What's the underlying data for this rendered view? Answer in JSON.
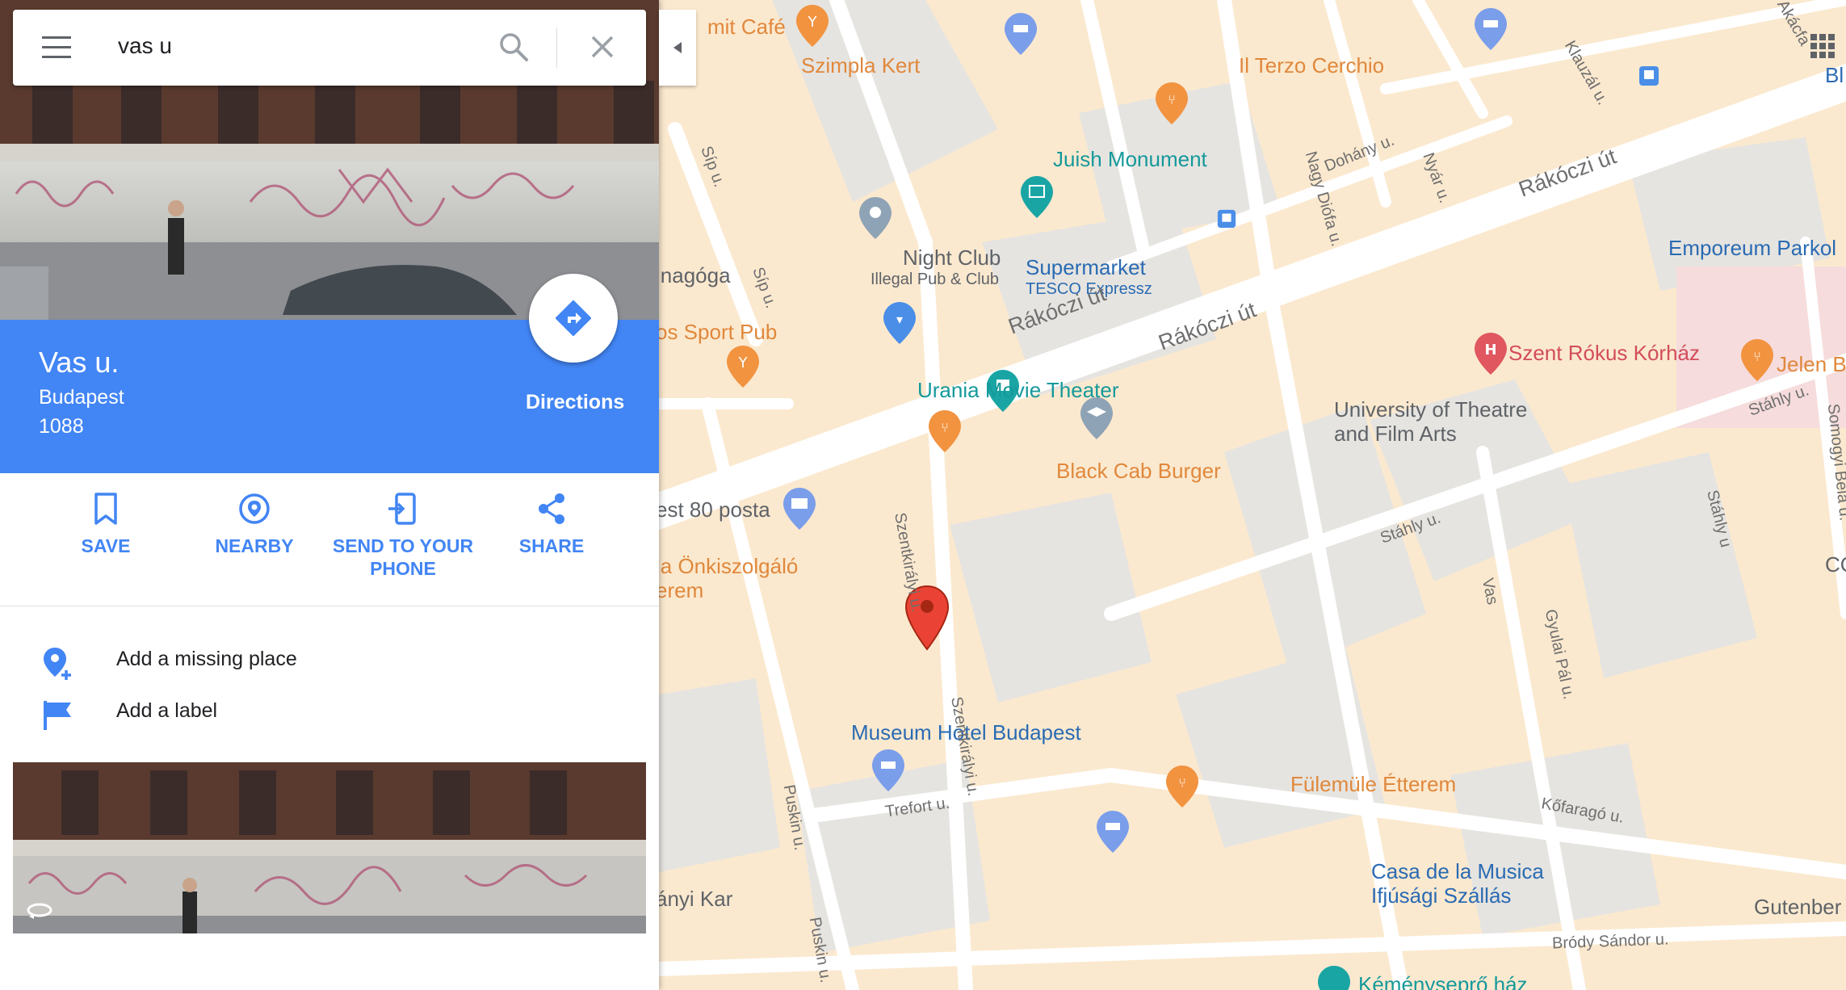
{
  "search": {
    "query": "vas u"
  },
  "place": {
    "name": "Vas u.",
    "city": "Budapest",
    "postal_code": "1088",
    "directions_label": "Directions"
  },
  "actions": [
    {
      "label": "SAVE",
      "icon": "bookmark-icon"
    },
    {
      "label": "NEARBY",
      "icon": "nearby-icon"
    },
    {
      "label": "SEND TO YOUR PHONE",
      "icon": "send-to-phone-icon"
    },
    {
      "label": "SHARE",
      "icon": "share-icon"
    }
  ],
  "list": [
    {
      "label": "Add a missing place",
      "icon": "add-place-icon"
    },
    {
      "label": "Add a label",
      "icon": "flag-icon"
    }
  ],
  "colors": {
    "accent": "#4285f4",
    "map_block": "#fbe9cf",
    "map_road": "#ffffff",
    "marker": "#ea4335",
    "poi_orange": "#e0883c",
    "poi_teal": "#15999b"
  },
  "map": {
    "poi": {
      "szimpla_cafe": "mit Café",
      "szimpla_kert": "Szimpla Kert",
      "il_terzo": "Il Terzo Cerchio",
      "juish": "Juish Monument",
      "night_club": "Night Club",
      "night_club_sub": "Illegal Pub & Club",
      "supermarket": "Supermarket",
      "supermarket_sub": "TESCO Expressz",
      "emporeum": "Emporeum Parkol",
      "zsinagoga": "inagóga",
      "sport_pub": "os Sport Pub",
      "szent_rokus": "Szent Rókus Kórház",
      "jelen": "Jelen B",
      "urania": "Urania Movie Theater",
      "university_1": "University of Theatre",
      "university_2": "and Film Arts",
      "black_cab": "Black Cab Burger",
      "posta": "est 80 posta",
      "onkiszolgalo_1": "la Önkiszolgáló",
      "onkiszolgalo_2": "erem",
      "museum_hotel": "Museum Hotel Budapest",
      "fulemule": "Fülemüle Étterem",
      "casa_1": "Casa de la Musica",
      "casa_2": "Ifjúsági Szállás",
      "gutenberg": "Gutenber",
      "kar": "ányi Kar",
      "kemenysepro": "Kéményseprő ház",
      "bl": "Bl",
      "co": "CC"
    },
    "streets": {
      "rakoczi_1": "Rákóczi út",
      "rakoczi_2": "Rákóczi út",
      "rakoczi_3": "Rákóczi út",
      "sip_1": "Síp u.",
      "sip_2": "Síp u.",
      "dohany": "Dohány u.",
      "nyar": "Nyár u.",
      "nagy_diofa": "Nagy Diófa u.",
      "klauzal": "Klauzál u.",
      "akacfa": "Akácfa",
      "stahly_1": "Stáhly u.",
      "stahly_2": "Stáhly u.",
      "stahly_3": "Stáhly u",
      "szentkiralyi_1": "Szentkirályi u.",
      "szentkiralyi_2": "Szentkirályi u.",
      "vas": "Vas",
      "gyulai_pal": "Gyulai Pál u.",
      "somogyi": "Somogyi Béla u.",
      "puskin_1": "Puskin u.",
      "puskin_2": "Puskin u.",
      "trefort": "Trefort u.",
      "kofarago": "Kőfaragó u.",
      "brody": "Bródy Sándor u."
    }
  }
}
